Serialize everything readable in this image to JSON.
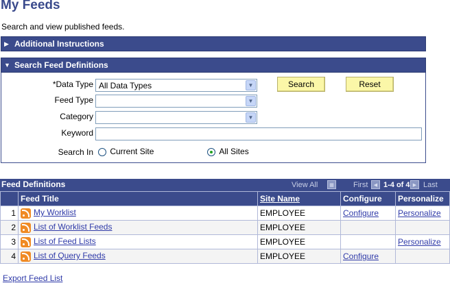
{
  "page": {
    "title": "My Feeds",
    "description": "Search and view published feeds."
  },
  "sections": {
    "additional": {
      "label": "Additional Instructions",
      "expanded": false
    },
    "search": {
      "label": "Search Feed Definitions",
      "expanded": true
    }
  },
  "search": {
    "data_type_label": "*Data Type",
    "data_type_value": "All Data Types",
    "feed_type_label": "Feed Type",
    "feed_type_value": "",
    "category_label": "Category",
    "category_value": "",
    "keyword_label": "Keyword",
    "keyword_value": "",
    "search_in_label": "Search In",
    "current_site_label": "Current Site",
    "all_sites_label": "All Sites",
    "selected_scope": "All Sites",
    "search_button": "Search",
    "reset_button": "Reset"
  },
  "grid": {
    "title": "Feed Definitions",
    "view_all": "View All",
    "first": "First",
    "range": "1-4 of 4",
    "last": "Last",
    "columns": {
      "title": "Feed Title",
      "site": "Site Name",
      "configure": "Configure",
      "personalize": "Personalize"
    },
    "rows": [
      {
        "num": "1",
        "title": "My Worklist",
        "site": "EMPLOYEE",
        "configure": "Configure",
        "personalize": "Personalize"
      },
      {
        "num": "2",
        "title": "List of Worklist Feeds",
        "site": "EMPLOYEE",
        "configure": "",
        "personalize": ""
      },
      {
        "num": "3",
        "title": "List of Feed Lists",
        "site": "EMPLOYEE",
        "configure": "",
        "personalize": "Personalize"
      },
      {
        "num": "4",
        "title": "List of Query Feeds",
        "site": "EMPLOYEE",
        "configure": "Configure",
        "personalize": ""
      }
    ]
  },
  "footer": {
    "export_label": "Export Feed List"
  },
  "colors": {
    "header_blue": "#3b4b8c",
    "button_yellow": "#fbf7a8",
    "link": "#2f3aa8",
    "rss_orange": "#f08a24"
  },
  "icons": [
    "triangle-right-icon",
    "triangle-down-icon",
    "chevron-down-icon",
    "rss-icon",
    "view-all-icon",
    "first-arrow-icon",
    "last-arrow-icon"
  ]
}
